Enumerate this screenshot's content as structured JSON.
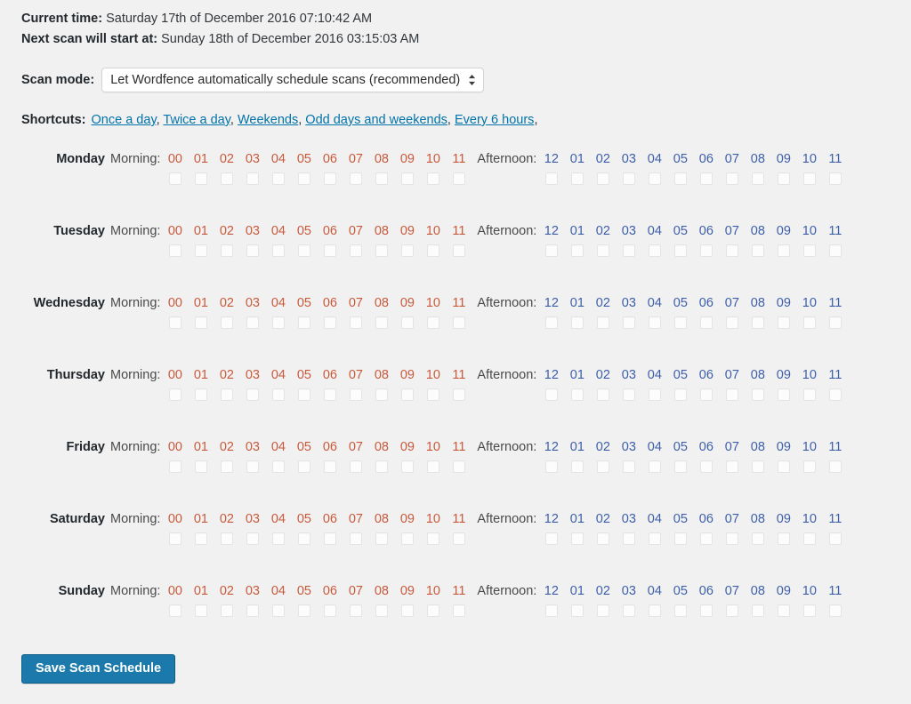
{
  "status": {
    "current_time_label": "Current time:",
    "current_time_value": "Saturday 17th of December 2016 07:10:42 AM",
    "next_scan_label": "Next scan will start at:",
    "next_scan_value": "Sunday 18th of December 2016 03:15:03 AM"
  },
  "scan_mode": {
    "label": "Scan mode:",
    "selected": "Let Wordfence automatically schedule scans (recommended)"
  },
  "shortcuts": {
    "label": "Shortcuts:",
    "links": [
      "Once a day",
      "Twice a day",
      "Weekends",
      "Odd days and weekends",
      "Every 6 hours"
    ],
    "separator": ", ",
    "trailing": ","
  },
  "schedule": {
    "morning_label": "Morning:",
    "afternoon_label": "Afternoon:",
    "morning_hours": [
      "00",
      "01",
      "02",
      "03",
      "04",
      "05",
      "06",
      "07",
      "08",
      "09",
      "10",
      "11"
    ],
    "afternoon_hours": [
      "12",
      "01",
      "02",
      "03",
      "04",
      "05",
      "06",
      "07",
      "08",
      "09",
      "10",
      "11"
    ],
    "days": [
      {
        "name": "Monday",
        "morning_checked": [
          false,
          false,
          false,
          false,
          false,
          false,
          false,
          false,
          false,
          false,
          false,
          false
        ],
        "afternoon_checked": [
          false,
          false,
          false,
          false,
          false,
          false,
          false,
          false,
          false,
          false,
          false,
          false
        ]
      },
      {
        "name": "Tuesday",
        "morning_checked": [
          false,
          false,
          false,
          false,
          false,
          false,
          false,
          false,
          false,
          false,
          false,
          false
        ],
        "afternoon_checked": [
          false,
          false,
          false,
          false,
          false,
          false,
          false,
          false,
          false,
          false,
          false,
          false
        ]
      },
      {
        "name": "Wednesday",
        "morning_checked": [
          false,
          false,
          false,
          false,
          false,
          false,
          false,
          false,
          false,
          false,
          false,
          false
        ],
        "afternoon_checked": [
          false,
          false,
          false,
          false,
          false,
          false,
          false,
          false,
          false,
          false,
          false,
          false
        ]
      },
      {
        "name": "Thursday",
        "morning_checked": [
          false,
          false,
          false,
          false,
          false,
          false,
          false,
          false,
          false,
          false,
          false,
          false
        ],
        "afternoon_checked": [
          false,
          false,
          false,
          false,
          false,
          false,
          false,
          false,
          false,
          false,
          false,
          false
        ]
      },
      {
        "name": "Friday",
        "morning_checked": [
          false,
          false,
          false,
          false,
          false,
          false,
          false,
          false,
          false,
          false,
          false,
          false
        ],
        "afternoon_checked": [
          false,
          false,
          false,
          false,
          false,
          false,
          false,
          false,
          false,
          false,
          false,
          false
        ]
      },
      {
        "name": "Saturday",
        "morning_checked": [
          false,
          false,
          false,
          false,
          false,
          false,
          false,
          false,
          false,
          false,
          false,
          false
        ],
        "afternoon_checked": [
          false,
          false,
          false,
          false,
          false,
          false,
          false,
          false,
          false,
          false,
          false,
          false
        ]
      },
      {
        "name": "Sunday",
        "morning_checked": [
          false,
          false,
          false,
          false,
          false,
          false,
          false,
          false,
          false,
          false,
          false,
          false
        ],
        "afternoon_checked": [
          false,
          false,
          false,
          false,
          false,
          false,
          false,
          false,
          false,
          false,
          false,
          false
        ]
      }
    ]
  },
  "save": {
    "label": "Save Scan Schedule"
  },
  "colors": {
    "background": "#f1f1f1",
    "morning_hour": "#c85a3c",
    "afternoon_hour": "#3d5fa8",
    "link": "#0073aa",
    "button": "#1b7aab"
  }
}
